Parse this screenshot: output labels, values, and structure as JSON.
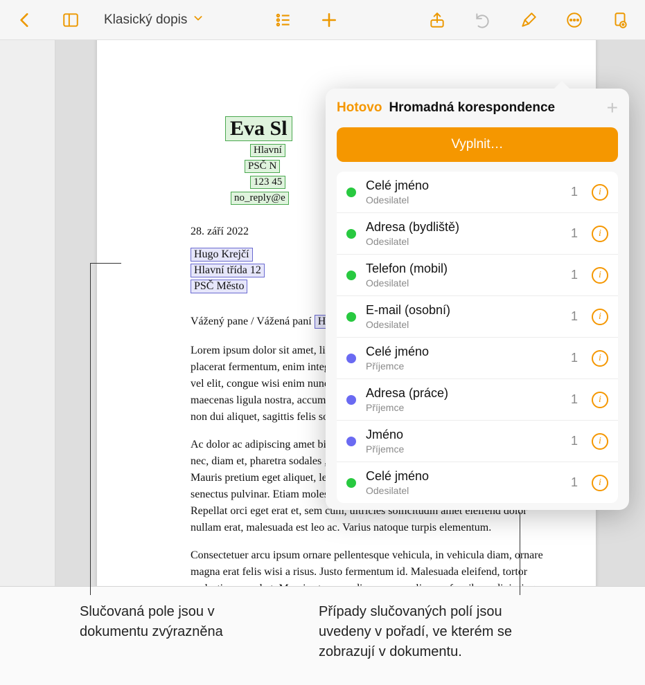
{
  "toolbar": {
    "doc_title": "Klasický dopis"
  },
  "popover": {
    "done_label": "Hotovo",
    "title": "Hromadná korespondence",
    "fill_label": "Vyplnit…",
    "fields": [
      {
        "name": "Celé jméno",
        "role": "Odesilatel",
        "count": "1",
        "color": "green"
      },
      {
        "name": "Adresa (bydliště)",
        "role": "Odesilatel",
        "count": "1",
        "color": "green"
      },
      {
        "name": "Telefon (mobil)",
        "role": "Odesilatel",
        "count": "1",
        "color": "green"
      },
      {
        "name": "E-mail (osobní)",
        "role": "Odesilatel",
        "count": "1",
        "color": "green"
      },
      {
        "name": "Celé jméno",
        "role": "Příjemce",
        "count": "1",
        "color": "purple"
      },
      {
        "name": "Adresa (práce)",
        "role": "Příjemce",
        "count": "1",
        "color": "purple"
      },
      {
        "name": "Jméno",
        "role": "Příjemce",
        "count": "1",
        "color": "purple"
      },
      {
        "name": "Celé jméno",
        "role": "Odesilatel",
        "count": "1",
        "color": "green"
      }
    ]
  },
  "document": {
    "sender_name": "Eva Sl",
    "sender_line1": "Hlavní",
    "sender_line2": "PSČ N",
    "sender_line3": "123 45",
    "sender_line4": "no_reply@e",
    "date": "28. září 2022",
    "recipient_name": "Hugo Krejčí",
    "recipient_addr1": "Hlavní třída 12",
    "recipient_addr2": "PSČ Město",
    "salutation_prefix": "Vážený pane / Vážená paní ",
    "salutation_merge": "Hugo",
    "salutation_suffix": ",",
    "body_p1": "Lorem ipsum dolor sit amet, ligula suspendisse nulla pretium, rhoncus tempor placerat fermentum, enim integer ad vestibulum volutpat. Nisl rhoncus turpis est, vel elit, congue wisi enim nunc ultricies sit, magna tincidunt. Maecenas aliquam maecenas ligula nostra, accumsan taciti. Sociis mauris in integer, a dolor netus non dui aliquet, sagittis felis sodales, dolor sociis mauris, vel eu libero cras.",
    "body_p2": "Ac dolor ac adipiscing amet bibendum nullam, massa lacus molestie ut libero nec, diam et, pharetra sodales , feugiat ullamcorper id tempor eget id vitae. Mauris pretium eget aliquet, lectus tincidunt. Porttitor mollis imperdiet libero senectus pulvinar. Etiam molestie mauris ligula laoreet, vehicula eleifend. Repellat orci eget erat et, sem cum, ultricies sollicitudin amet eleifend dolor nullam erat, malesuada est leo ac. Varius natoque turpis elementum.",
    "body_p3": "Consectetuer arcu ipsum ornare pellentesque vehicula, in vehicula diam, ornare magna erat felis wisi a risus. Justo fermentum id. Malesuada eleifend, tortor molestie, a a vel et. Mauris at suspendisse, neque aliquam faucibus adipiscing, vivamus in. Wisi mattis leo suscipit nec amet, nisl fermentum tempor ac a, augue in."
  },
  "callouts": {
    "left": "Slučovaná pole jsou v dokumentu zvýrazněna",
    "right": "Případy slučovaných polí jsou uvedeny v pořadí, ve kterém se zobrazují v dokumentu."
  }
}
